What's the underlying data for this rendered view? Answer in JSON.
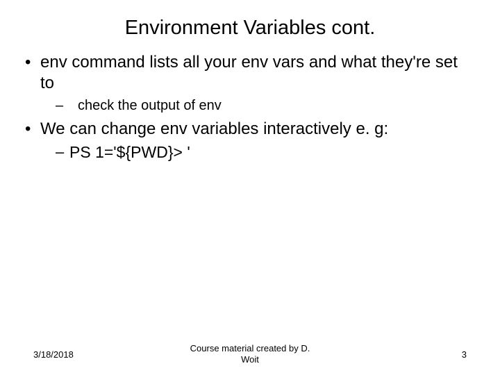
{
  "slide": {
    "title": "Environment Variables cont.",
    "bullets": [
      {
        "text": "env command lists all your env vars and what they're set to",
        "sub": [
          {
            "text": "check the output of env",
            "style": "dash"
          }
        ]
      },
      {
        "text": "We can change env variables interactively e. g:",
        "sub": [
          {
            "text": "PS 1='${PWD}> '",
            "style": "dash-tight"
          }
        ]
      }
    ]
  },
  "footer": {
    "date": "3/18/2018",
    "center": "Course material created by D. Woit",
    "page": "3"
  }
}
